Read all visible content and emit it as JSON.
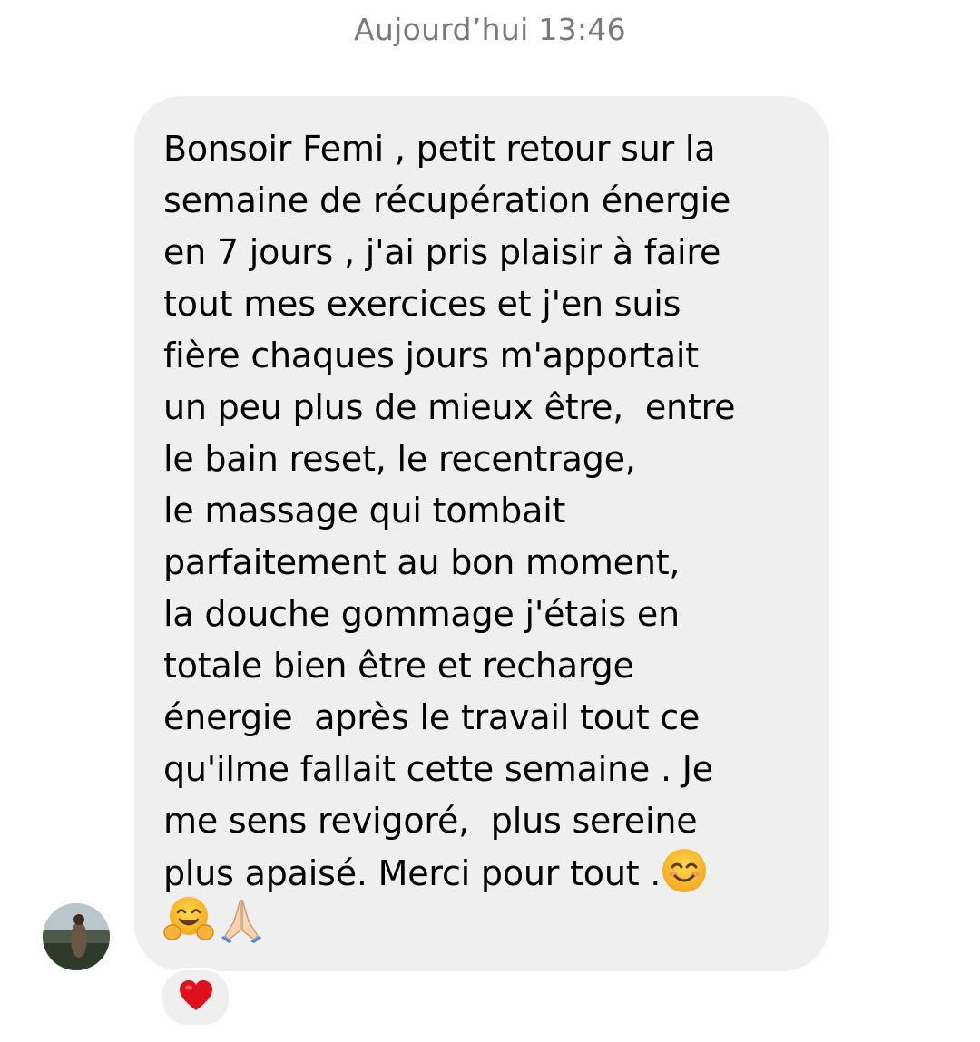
{
  "conversation": {
    "timestamp": "Aujourd’hui 13:46"
  },
  "message": {
    "text": "Bonsoir Femi , petit retour sur la\nsemaine de récupération énergie\nen 7 jours , j'ai pris plaisir à faire\ntout mes exercices et j'en suis\nfière chaques jours m'apportait\nun peu plus de mieux être,  entre\nle bain reset, le recentrage,\nle massage qui tombait\nparfaitement au bon moment,\nla douche gommage j'étais en\ntotale bien être et recharge\nénergie  après le travail tout ce\nqu'ilme fallait cette semaine . Je\nme sens revigoré,  plus sereine\nplus apaisé. Merci pour tout .",
    "inline_emoji": "smiling-face-with-smiling-eyes",
    "trailing_emojis": [
      "hugging-face",
      "folded-hands"
    ],
    "bubble_color": "#efefef",
    "text_color": "#000000"
  },
  "sender": {
    "avatar": "profile-photo"
  },
  "reaction": {
    "emoji": "red-heart",
    "color": "#e0101f"
  },
  "colors": {
    "timestamp": "#7a7a7a",
    "background": "#ffffff"
  }
}
